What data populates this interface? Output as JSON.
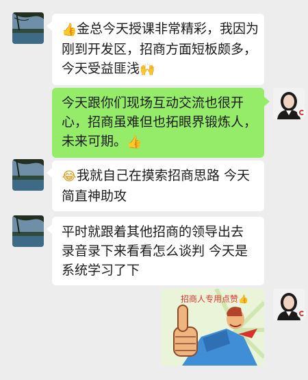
{
  "messages": [
    {
      "side": "left",
      "lines": [
        "金总今天授课非常精彩，我因为",
        "刚到开发区，招商方面短板颇多，",
        "今天受益匪浅"
      ],
      "lead_icon": "thumbs-up-icon",
      "tail_icon": "clapping-hands-icon"
    },
    {
      "side": "right",
      "lines": [
        "今天跟你们现场互动交流也很开",
        "心，招商虽难但也拓眼界锻炼人，",
        "未来可期。"
      ],
      "tail_icon": "thumbs-up-icon"
    },
    {
      "side": "left",
      "lines": [
        "我就自己在摸索招商思路 今天",
        "简直神助攻"
      ],
      "lead_icon": "laughing-tears-icon"
    },
    {
      "side": "left",
      "lines": [
        "平时就跟着其他招商的领导出去",
        "录音录下来看看怎么谈判 今天是",
        "系统学习了下"
      ]
    }
  ],
  "sticker": {
    "caption": "招商人专用点赞",
    "caption_icon": "thumbs-up-icon"
  },
  "colors": {
    "background": "#ededed",
    "incoming_bubble": "#ffffff",
    "outgoing_bubble": "#95ec69",
    "brand_red": "#e2322f"
  }
}
